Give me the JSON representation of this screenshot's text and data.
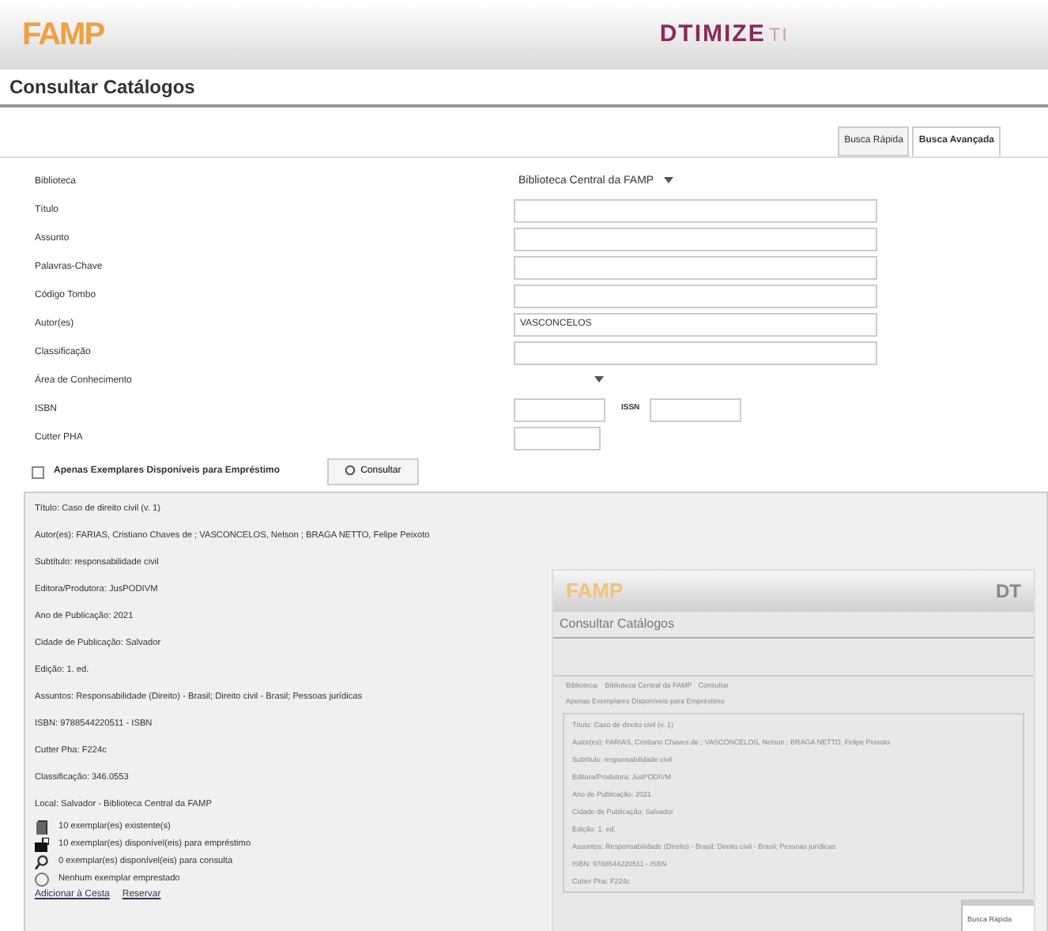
{
  "header": {
    "logo": "FAMP",
    "brand": "DTIMIZE",
    "brand_suffix": "TI"
  },
  "page_title": "Consultar Catálogos",
  "tabs": [
    {
      "label": "Busca Rápida",
      "selected": false
    },
    {
      "label": "Busca Avançada",
      "selected": true
    }
  ],
  "form": [
    {
      "label": "Biblioteca",
      "kind": "select",
      "value": "Biblioteca Central da FAMP"
    },
    {
      "label": "Título",
      "kind": "text"
    },
    {
      "label": "Assunto",
      "kind": "text"
    },
    {
      "label": "Palavras-Chave",
      "kind": "text"
    },
    {
      "label": "Código Tombo",
      "kind": "text"
    },
    {
      "label": "Autor(es)",
      "kind": "text",
      "value": "VASCONCELOS"
    },
    {
      "label": "Classificação",
      "kind": "text"
    },
    {
      "label": "Área de Conhecimento",
      "kind": "select"
    },
    {
      "label": "ISBN",
      "kind": "pair",
      "second_label": "ISSN"
    },
    {
      "label": "Cutter PHA",
      "kind": "short"
    }
  ],
  "available_only": {
    "label": "Apenas Exemplares Disponíveis para Empréstimo",
    "checked": false
  },
  "search_button": "Consultar",
  "record": {
    "lines": [
      "Título: Caso de direito civil (v. 1)",
      "Autor(es): FARIAS, Cristiano Chaves de ; VASCONCELOS, Nelson ; BRAGA NETTO, Felipe Peixoto",
      "Subtítulo: responsabilidade civil",
      "Editora/Produtora: JusPODIVM",
      "Ano de Publicação: 2021",
      "Cidade de Publicação: Salvador",
      "Edição: 1. ed.",
      "Assuntos: Responsabilidade (Direito) - Brasil; Direito civil - Brasil; Pessoas jurídicas",
      "ISBN: 9788544220511 - ISBN",
      "Cutter Pha: F224c",
      "Classificação: 346.0553",
      "Local: Salvador - Biblioteca Central da FAMP"
    ],
    "status": [
      {
        "kind": "existing",
        "text": "10 exemplar(es) existente(s)"
      },
      {
        "kind": "loan",
        "text": "10 exemplar(es) disponível(eis) para empréstimo"
      },
      {
        "kind": "consult",
        "text": "0 exemplar(es) disponível(eis) para consulta"
      },
      {
        "kind": "borrowed",
        "text": "Nenhum exemplar emprestado"
      }
    ],
    "links": [
      "Adicionar à Cesta",
      "Reservar"
    ]
  },
  "inset": {
    "logo": "FAMP",
    "brand": "DT",
    "page_title": "Consultar Catálogos",
    "library_label": "Biblioteca:",
    "library_value": "Biblioteca Central da FAMP",
    "button": "Consultar",
    "available_label": "Apenas Exemplares Disponíveis para Empréstimo",
    "lines": [
      "Título: Caso de direito civil (v. 1)",
      "Autor(es): FARIAS, Cristiano Chaves de ; VASCONCELOS, Nelson ; BRAGA NETTO, Felipe Peixoto",
      "Subtítulo: responsabilidade civil",
      "Editora/Produtora: JusPODIVM",
      "Ano de Publicação: 2021",
      "Cidade de Publicação: Salvador",
      "Edição: 1. ed.",
      "Assuntos: Responsabilidade (Direito) - Brasil; Direito civil - Brasil; Pessoas jurídicas",
      "ISBN: 9788544220511 - ISBN",
      "Cutter Pha: F224c"
    ],
    "popup_tab": "Busca Rápida"
  }
}
